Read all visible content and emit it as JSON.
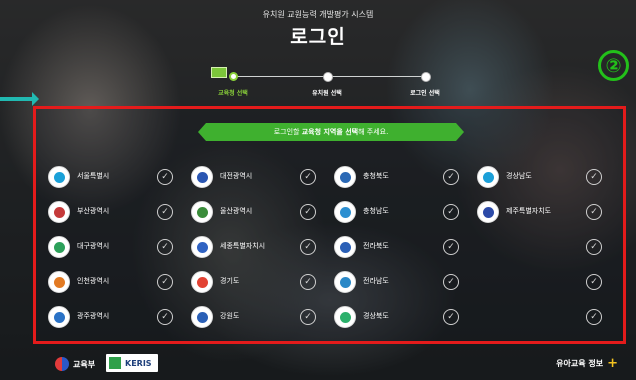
{
  "header": {
    "subtitle": "유치원 교원능력 개발평가 시스템",
    "title": "로그인"
  },
  "steps": [
    {
      "label": "교육청 선택",
      "active": true
    },
    {
      "label": "유치원 선택",
      "active": false
    },
    {
      "label": "로그인 선택",
      "active": false
    }
  ],
  "annotation": {
    "badge": "②"
  },
  "notice": {
    "prefix": "로그인할",
    "highlight": "교육청 지역을 선택",
    "suffix": "해 주세요."
  },
  "regions": [
    {
      "name": "서울특별시",
      "color": "#1aa0d8"
    },
    {
      "name": "대전광역시",
      "color": "#2a56b2"
    },
    {
      "name": "충청북도",
      "color": "#2a68b5"
    },
    {
      "name": "경상남도",
      "color": "#1b9fd8"
    },
    {
      "name": "부산광역시",
      "color": "#c53a3a"
    },
    {
      "name": "울산광역시",
      "color": "#3a8c3a"
    },
    {
      "name": "충청남도",
      "color": "#2c8fd1"
    },
    {
      "name": "제주특별자치도",
      "color": "#2c4aa8"
    },
    {
      "name": "대구광역시",
      "color": "#2ca05a"
    },
    {
      "name": "세종특별자치시",
      "color": "#2f62c2"
    },
    {
      "name": "전라북도",
      "color": "#2a5fb6"
    },
    {
      "name": "",
      "color": ""
    },
    {
      "name": "인천광역시",
      "color": "#e27a23"
    },
    {
      "name": "경기도",
      "color": "#e24233"
    },
    {
      "name": "전라남도",
      "color": "#2a88c7"
    },
    {
      "name": "",
      "color": ""
    },
    {
      "name": "광주광역시",
      "color": "#2a72c6"
    },
    {
      "name": "강원도",
      "color": "#2a5fb6"
    },
    {
      "name": "경상북도",
      "color": "#2bb06b"
    },
    {
      "name": "",
      "color": ""
    }
  ],
  "check_icon": "check-circle-icon",
  "footer": {
    "ministry": "교육부",
    "keris": "KERIS",
    "brand": "유아교육 정보"
  },
  "colors": {
    "accent": "#3fb02f",
    "highlight_border": "#e41b1b",
    "arrow": "#21b9b1"
  }
}
